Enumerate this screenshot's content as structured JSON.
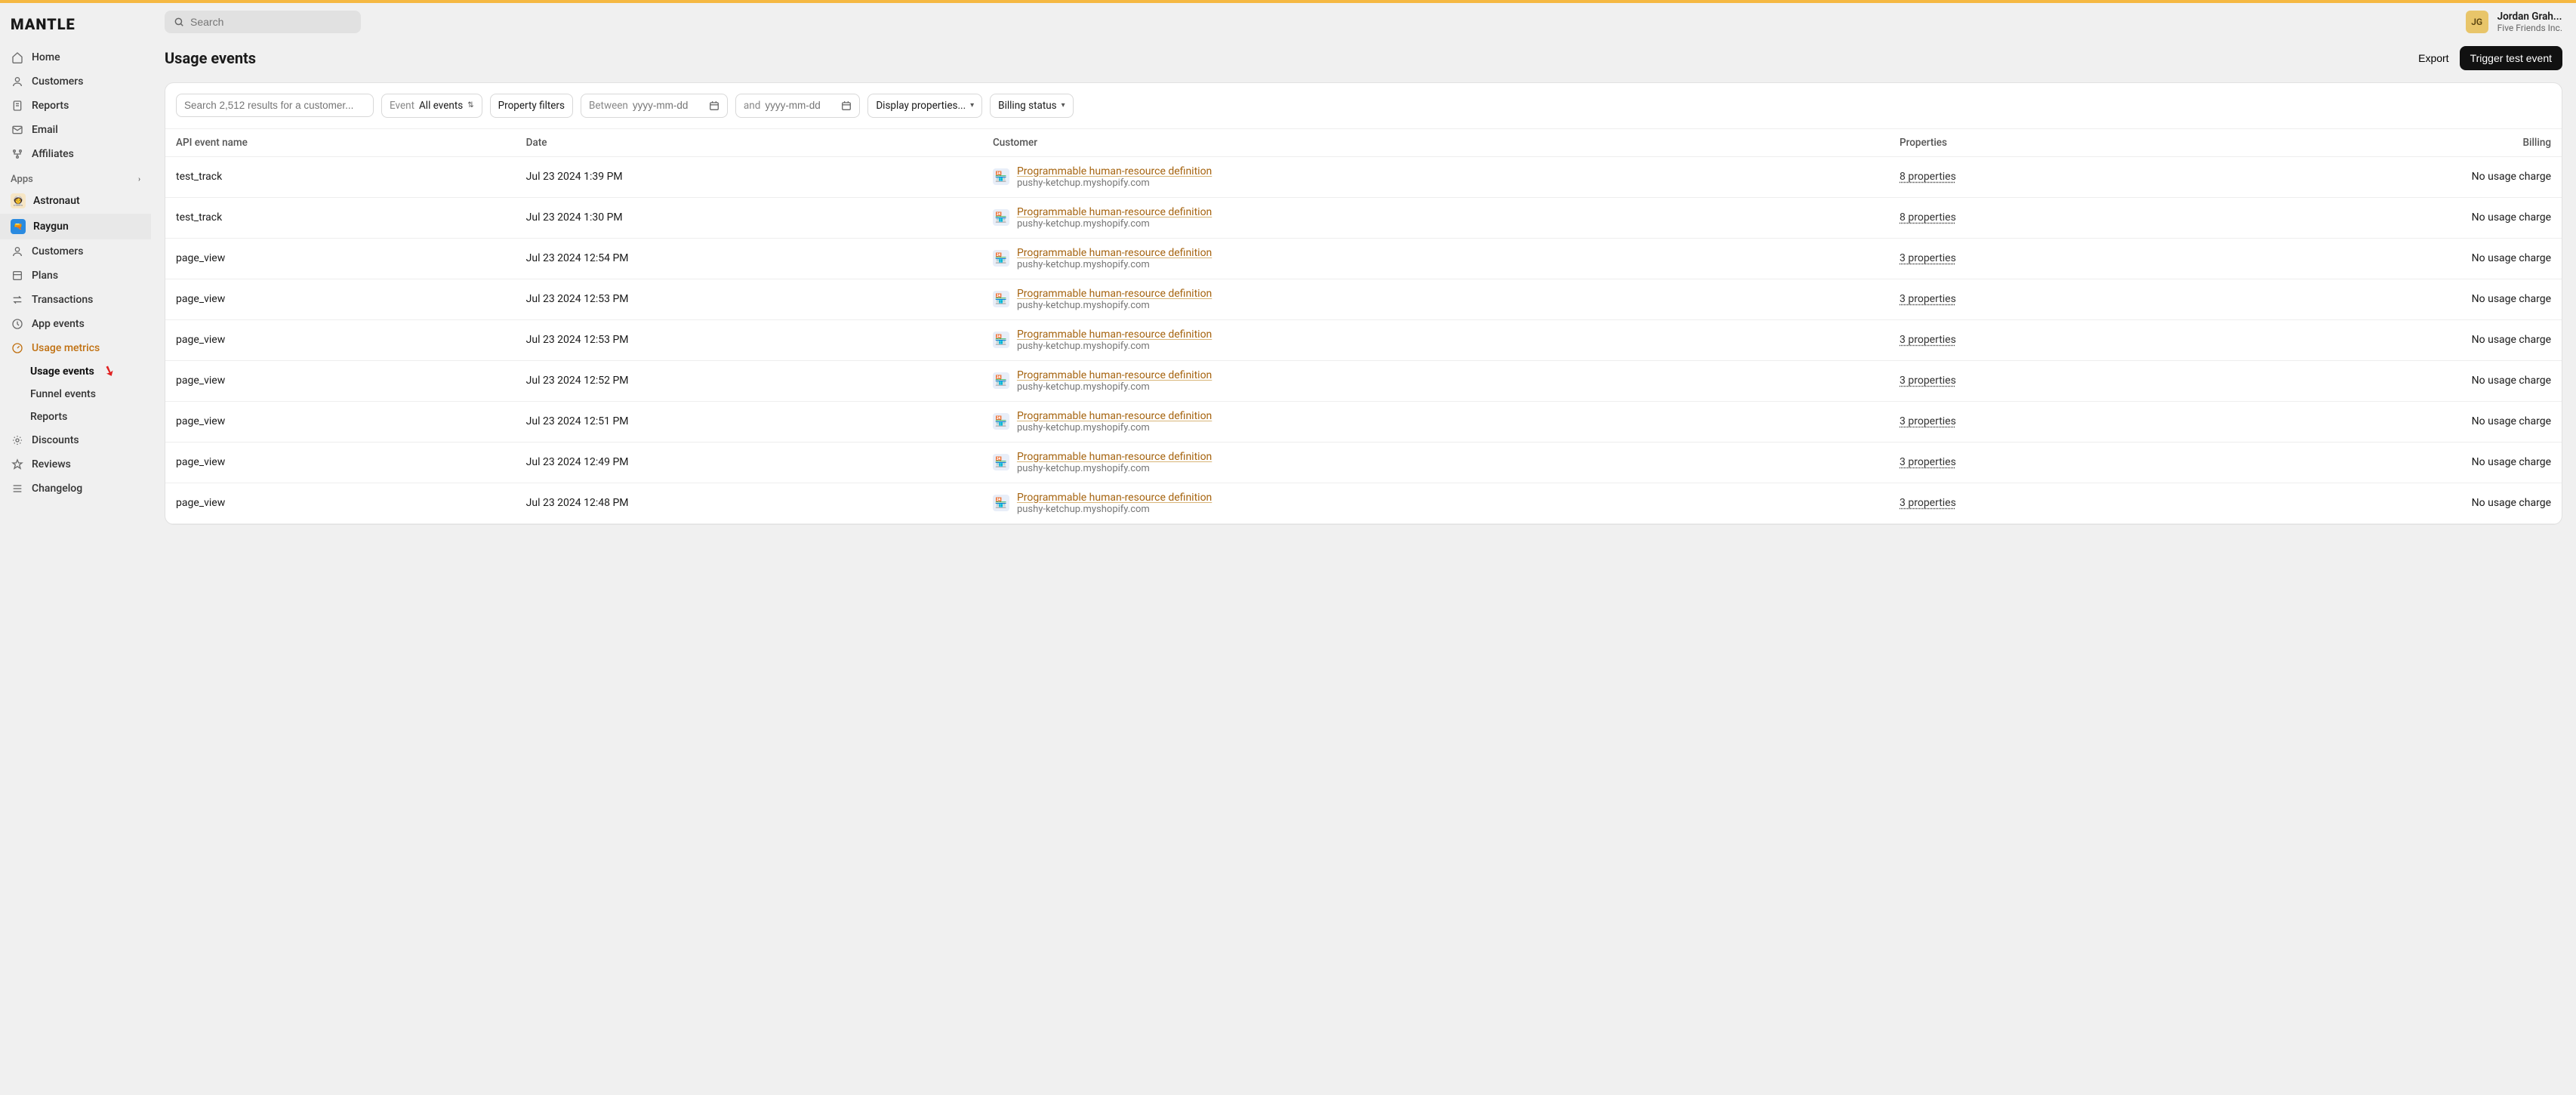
{
  "brand": "MANTLE",
  "search": {
    "placeholder": "Search"
  },
  "user": {
    "initials": "JG",
    "name": "Jordan Grah...",
    "org": "Five Friends Inc."
  },
  "nav_main": [
    {
      "key": "home",
      "label": "Home"
    },
    {
      "key": "customers",
      "label": "Customers"
    },
    {
      "key": "reports",
      "label": "Reports"
    },
    {
      "key": "email",
      "label": "Email"
    },
    {
      "key": "affiliates",
      "label": "Affiliates"
    }
  ],
  "apps_label": "Apps",
  "apps": [
    {
      "key": "astronaut",
      "label": "Astronaut",
      "badge": "👩‍🚀"
    },
    {
      "key": "raygun",
      "label": "Raygun",
      "badge": "🔫",
      "selected": true
    }
  ],
  "nav_app": [
    {
      "key": "customers",
      "label": "Customers"
    },
    {
      "key": "plans",
      "label": "Plans"
    },
    {
      "key": "transactions",
      "label": "Transactions"
    },
    {
      "key": "app-events",
      "label": "App events"
    },
    {
      "key": "usage-metrics",
      "label": "Usage metrics",
      "active_parent": true,
      "children": [
        {
          "key": "usage-events",
          "label": "Usage events",
          "selected": true
        },
        {
          "key": "funnel-events",
          "label": "Funnel events"
        },
        {
          "key": "reports",
          "label": "Reports"
        }
      ]
    },
    {
      "key": "discounts",
      "label": "Discounts"
    },
    {
      "key": "reviews",
      "label": "Reviews"
    },
    {
      "key": "changelog",
      "label": "Changelog"
    }
  ],
  "page": {
    "title": "Usage events",
    "export_label": "Export",
    "trigger_label": "Trigger test event"
  },
  "filters": {
    "search_placeholder": "Search 2,512 results for a customer...",
    "event_label": "Event",
    "event_value": "All events",
    "property_filters_label": "Property filters",
    "between_label": "Between",
    "date_placeholder": "yyyy-mm-dd",
    "and_label": "and",
    "display_props_label": "Display properties...",
    "billing_status_label": "Billing status"
  },
  "columns": {
    "api_event": "API event name",
    "date": "Date",
    "customer": "Customer",
    "properties": "Properties",
    "billing": "Billing"
  },
  "rows": [
    {
      "api": "test_track",
      "date": "Jul 23 2024 1:39 PM",
      "customer_name": "Programmable human-resource definition",
      "customer_sub": "pushy-ketchup.myshopify.com",
      "props": "8 properties",
      "billing": "No usage charge"
    },
    {
      "api": "test_track",
      "date": "Jul 23 2024 1:30 PM",
      "customer_name": "Programmable human-resource definition",
      "customer_sub": "pushy-ketchup.myshopify.com",
      "props": "8 properties",
      "billing": "No usage charge"
    },
    {
      "api": "page_view",
      "date": "Jul 23 2024 12:54 PM",
      "customer_name": "Programmable human-resource definition",
      "customer_sub": "pushy-ketchup.myshopify.com",
      "props": "3 properties",
      "billing": "No usage charge"
    },
    {
      "api": "page_view",
      "date": "Jul 23 2024 12:53 PM",
      "customer_name": "Programmable human-resource definition",
      "customer_sub": "pushy-ketchup.myshopify.com",
      "props": "3 properties",
      "billing": "No usage charge"
    },
    {
      "api": "page_view",
      "date": "Jul 23 2024 12:53 PM",
      "customer_name": "Programmable human-resource definition",
      "customer_sub": "pushy-ketchup.myshopify.com",
      "props": "3 properties",
      "billing": "No usage charge"
    },
    {
      "api": "page_view",
      "date": "Jul 23 2024 12:52 PM",
      "customer_name": "Programmable human-resource definition",
      "customer_sub": "pushy-ketchup.myshopify.com",
      "props": "3 properties",
      "billing": "No usage charge"
    },
    {
      "api": "page_view",
      "date": "Jul 23 2024 12:51 PM",
      "customer_name": "Programmable human-resource definition",
      "customer_sub": "pushy-ketchup.myshopify.com",
      "props": "3 properties",
      "billing": "No usage charge"
    },
    {
      "api": "page_view",
      "date": "Jul 23 2024 12:49 PM",
      "customer_name": "Programmable human-resource definition",
      "customer_sub": "pushy-ketchup.myshopify.com",
      "props": "3 properties",
      "billing": "No usage charge"
    },
    {
      "api": "page_view",
      "date": "Jul 23 2024 12:48 PM",
      "customer_name": "Programmable human-resource definition",
      "customer_sub": "pushy-ketchup.myshopify.com",
      "props": "3 properties",
      "billing": "No usage charge"
    }
  ]
}
